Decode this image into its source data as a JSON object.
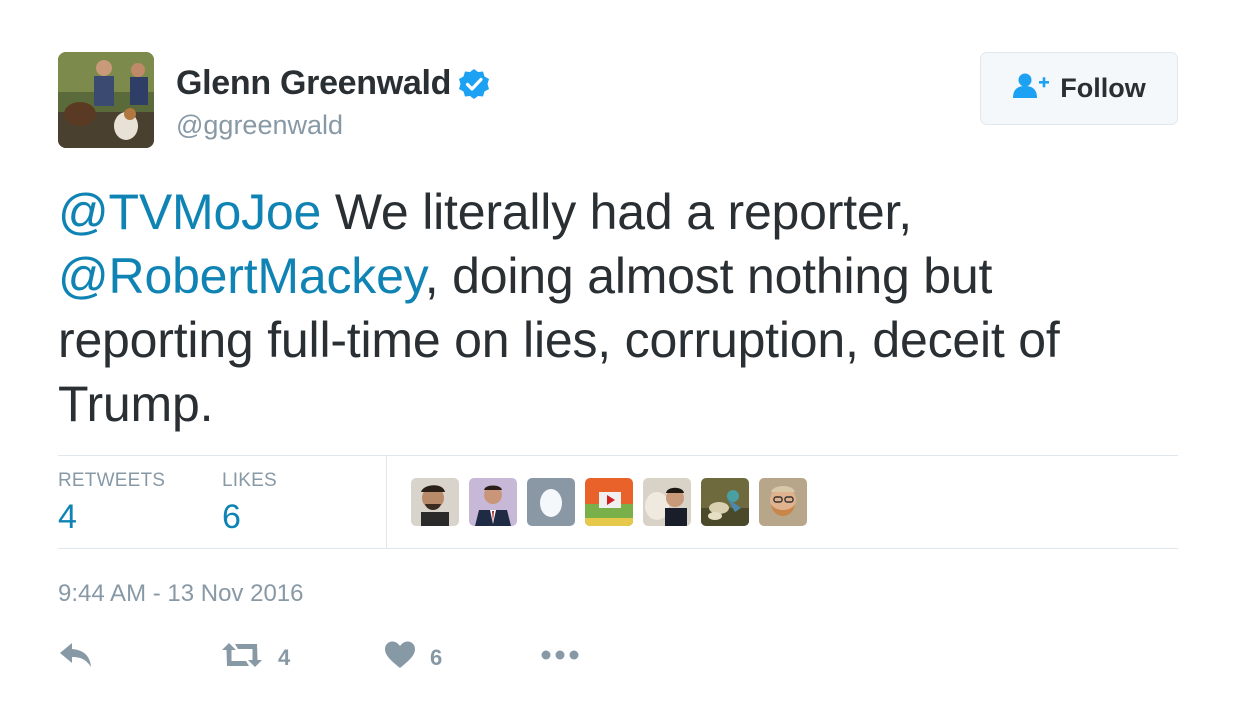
{
  "user": {
    "display_name": "Glenn Greenwald",
    "handle": "@ggreenwald",
    "verified": true
  },
  "follow_button": {
    "label": "Follow",
    "icon": "add-user-icon"
  },
  "tweet": {
    "parts": [
      {
        "type": "mention",
        "text": "@TVMoJoe"
      },
      {
        "type": "text",
        "text": " We literally had a reporter, "
      },
      {
        "type": "mention",
        "text": "@RobertMackey"
      },
      {
        "type": "text",
        "text": ", doing almost nothing but reporting full-time on lies, corruption, deceit of Trump."
      }
    ]
  },
  "stats": {
    "retweets_label": "RETWEETS",
    "retweets_value": "4",
    "likes_label": "LIKES",
    "likes_value": "6"
  },
  "likers": [
    {
      "name": "liker-avatar-1"
    },
    {
      "name": "liker-avatar-2"
    },
    {
      "name": "liker-avatar-3"
    },
    {
      "name": "liker-avatar-4"
    },
    {
      "name": "liker-avatar-5"
    },
    {
      "name": "liker-avatar-6"
    },
    {
      "name": "liker-avatar-7"
    }
  ],
  "timestamp": "9:44 AM - 13 Nov 2016",
  "actions": {
    "reply_icon": "reply-icon",
    "retweet_icon": "retweet-icon",
    "retweet_count": "4",
    "like_icon": "heart-icon",
    "like_count": "6",
    "more_icon": "more-icon"
  },
  "colors": {
    "link": "#0f84b4",
    "muted": "#8899a6",
    "text": "#292f33",
    "verified": "#1da1f2"
  }
}
